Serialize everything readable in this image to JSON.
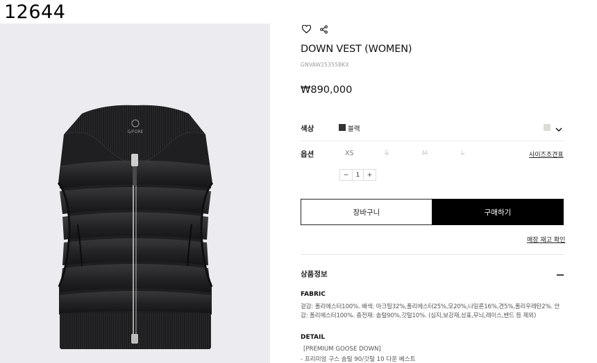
{
  "header": {
    "item_number": "12644"
  },
  "product": {
    "title": "DOWN VEST (WOMEN)",
    "code": "GNVAW25355BKX",
    "price": "₩890,000",
    "image_alt": "black down vest",
    "brand_logo_text": "G/FORE"
  },
  "options": {
    "color_label": "색상",
    "color_name": "블랙",
    "color_swatch": "#333333",
    "size_label": "옵션",
    "sizes": [
      {
        "label": "XS",
        "available": true
      },
      {
        "label": "S",
        "available": false
      },
      {
        "label": "M",
        "available": false
      },
      {
        "label": "L",
        "available": false
      }
    ],
    "size_chart_label": "사이즈조견표",
    "quantity": {
      "minus": "−",
      "value": "1",
      "plus": "+"
    }
  },
  "actions": {
    "cart_label": "장바구니",
    "buy_label": "구매하기",
    "store_stock_label": "매장 재고 확인"
  },
  "details": {
    "section_title": "상품정보",
    "fabric_heading": "FABRIC",
    "fabric_text": "겉감: 폴리에스터100%. 배색: 아크릴32%,폴리에스터25%,모20%,나일론16%,견5%,폴리우레탄2%. 안감: 폴리에스터100%. 충전재: 솜털90%,깃털10%. (심지,보강재,상표,무늬,레이스,밴드 등 제외)",
    "detail_heading": "DETAIL",
    "detail_line1": "[PREMIUM GOOSE DOWN]",
    "detail_line2": "- 프리미엄 구스 솜털 90/깃털 10 다운 베스트"
  }
}
